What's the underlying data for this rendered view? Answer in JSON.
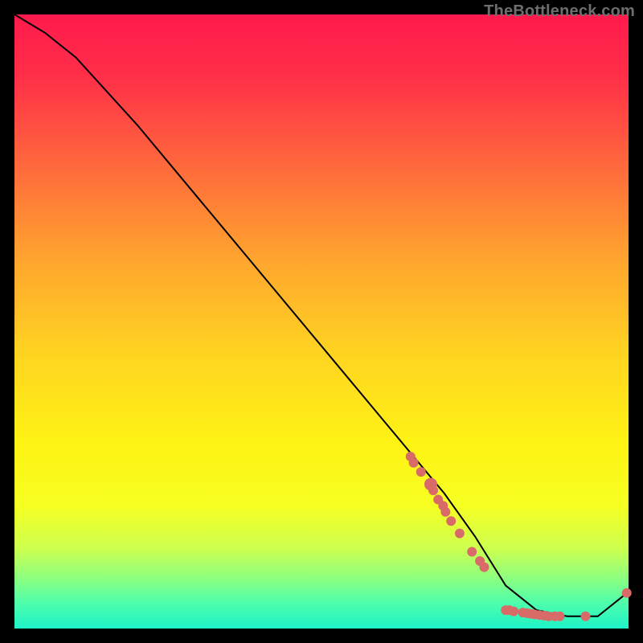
{
  "watermark": "TheBottleneck.com",
  "chart_data": {
    "type": "line",
    "title": "",
    "xlabel": "",
    "ylabel": "",
    "xlim": [
      0,
      100
    ],
    "ylim": [
      0,
      100
    ],
    "series": [
      {
        "name": "bottleneck-curve",
        "x": [
          0,
          5,
          10,
          20,
          30,
          40,
          50,
          60,
          70,
          75,
          80,
          85,
          90,
          95,
          100
        ],
        "y": [
          100,
          97,
          93,
          82,
          70,
          58,
          46,
          34,
          22,
          15,
          7,
          3,
          2,
          2,
          6
        ]
      }
    ],
    "markers": [
      {
        "x": 64.5,
        "y": 28.0,
        "r": 6
      },
      {
        "x": 65.0,
        "y": 27.0,
        "r": 6
      },
      {
        "x": 66.2,
        "y": 25.5,
        "r": 6
      },
      {
        "x": 67.8,
        "y": 23.5,
        "r": 8
      },
      {
        "x": 68.2,
        "y": 22.5,
        "r": 6
      },
      {
        "x": 69.0,
        "y": 21.0,
        "r": 6
      },
      {
        "x": 69.8,
        "y": 20.0,
        "r": 6
      },
      {
        "x": 70.2,
        "y": 19.0,
        "r": 6
      },
      {
        "x": 71.1,
        "y": 17.5,
        "r": 6
      },
      {
        "x": 72.5,
        "y": 15.5,
        "r": 6
      },
      {
        "x": 74.5,
        "y": 12.5,
        "r": 6
      },
      {
        "x": 75.8,
        "y": 11.0,
        "r": 6
      },
      {
        "x": 76.5,
        "y": 10.0,
        "r": 6
      },
      {
        "x": 80.0,
        "y": 3.0,
        "r": 6
      },
      {
        "x": 80.6,
        "y": 3.0,
        "r": 6
      },
      {
        "x": 81.3,
        "y": 2.8,
        "r": 6
      },
      {
        "x": 82.8,
        "y": 2.6,
        "r": 6
      },
      {
        "x": 83.5,
        "y": 2.5,
        "r": 6
      },
      {
        "x": 84.1,
        "y": 2.4,
        "r": 6
      },
      {
        "x": 84.7,
        "y": 2.3,
        "r": 6
      },
      {
        "x": 85.5,
        "y": 2.2,
        "r": 6
      },
      {
        "x": 86.3,
        "y": 2.1,
        "r": 6
      },
      {
        "x": 87.0,
        "y": 2.0,
        "r": 6
      },
      {
        "x": 88.0,
        "y": 2.0,
        "r": 6
      },
      {
        "x": 88.8,
        "y": 2.0,
        "r": 6
      },
      {
        "x": 93.0,
        "y": 2.0,
        "r": 6
      },
      {
        "x": 99.7,
        "y": 5.8,
        "r": 6
      }
    ],
    "gradient_stops": [
      {
        "offset": 0.0,
        "color": "#ff1a4d"
      },
      {
        "offset": 0.1,
        "color": "#ff2f48"
      },
      {
        "offset": 0.25,
        "color": "#ff6a3c"
      },
      {
        "offset": 0.4,
        "color": "#ffa52e"
      },
      {
        "offset": 0.55,
        "color": "#ffd321"
      },
      {
        "offset": 0.7,
        "color": "#fef314"
      },
      {
        "offset": 0.8,
        "color": "#f6ff22"
      },
      {
        "offset": 0.87,
        "color": "#ccff4f"
      },
      {
        "offset": 0.92,
        "color": "#8aff82"
      },
      {
        "offset": 0.96,
        "color": "#4cfdac"
      },
      {
        "offset": 1.0,
        "color": "#1ef3c8"
      }
    ],
    "marker_color": "#d86a68",
    "curve_color": "#000000",
    "plot_inset": {
      "left": 18,
      "right": 18,
      "top": 18,
      "bottom": 18
    }
  }
}
